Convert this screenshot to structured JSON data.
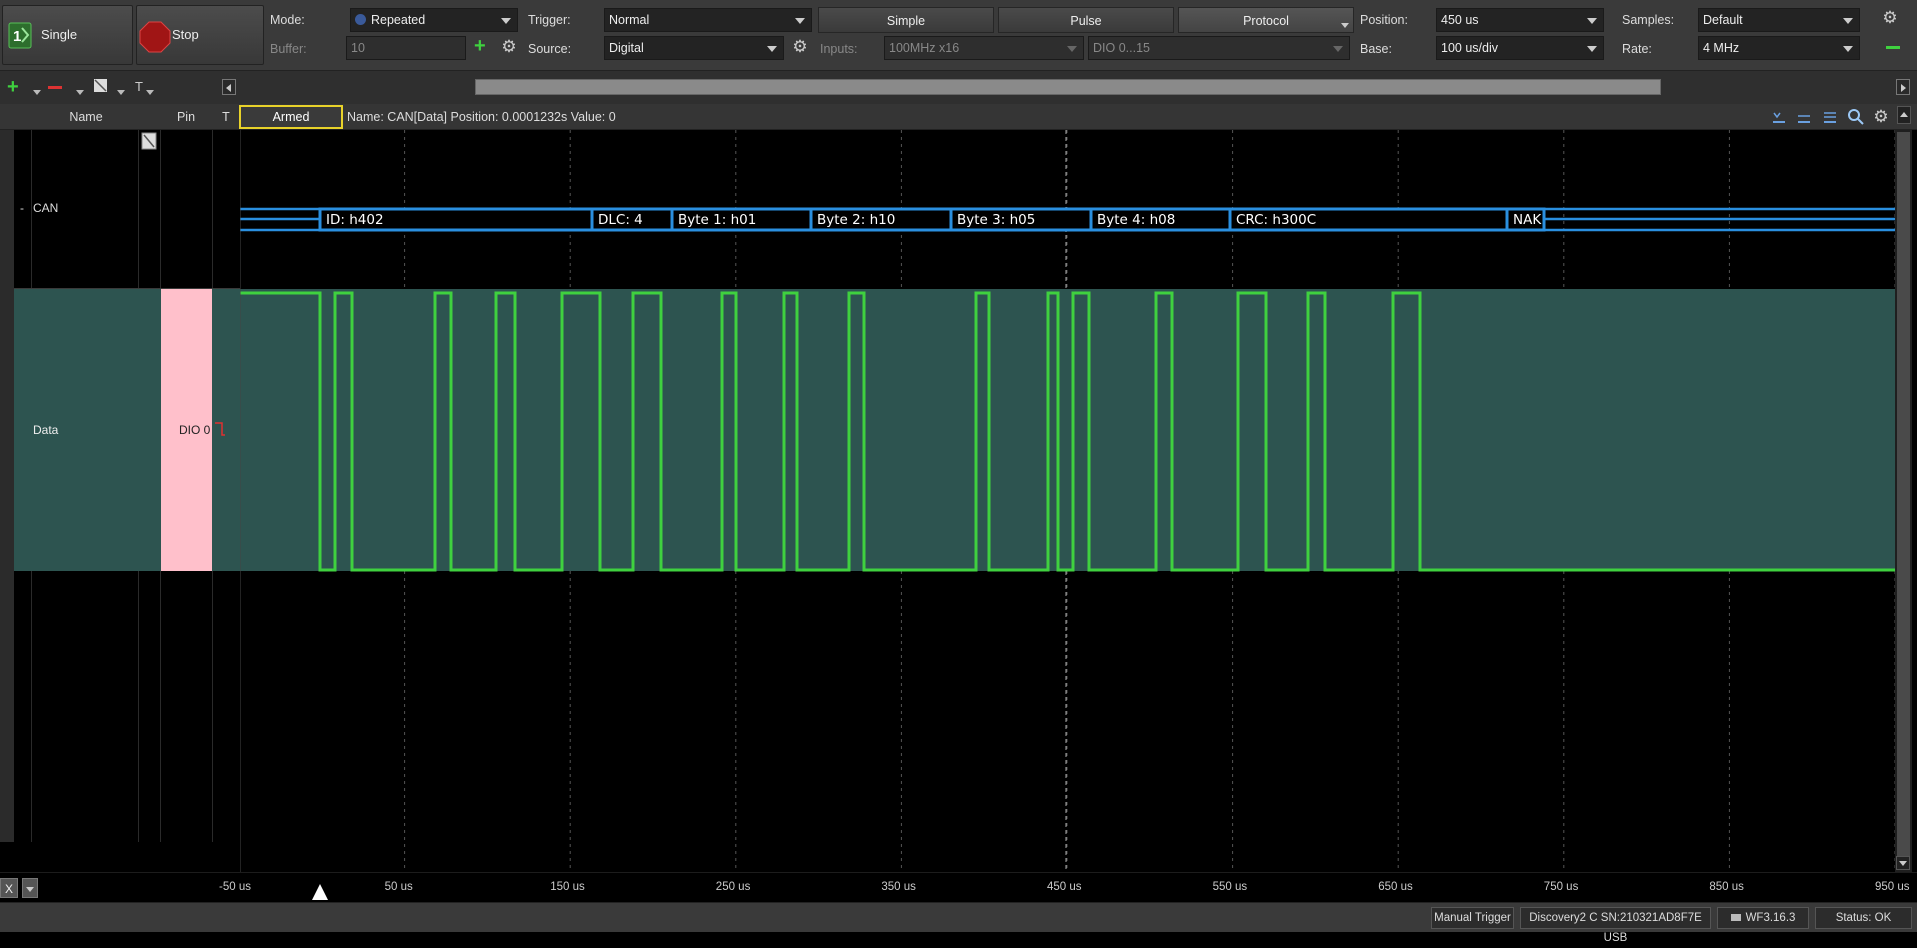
{
  "toolbar": {
    "single_label": "Single",
    "stop_label": "Stop",
    "mode_label": "Mode:",
    "mode_value": "Repeated",
    "buffer_label": "Buffer:",
    "buffer_value": "10",
    "trigger_label": "Trigger:",
    "trigger_value": "Normal",
    "source_label": "Source:",
    "source_value": "Digital",
    "inputs_label": "Inputs:",
    "inputs_value": "100MHz x16",
    "dio_range_value": "DIO 0...15",
    "tabs": [
      "Simple",
      "Pulse",
      "Protocol"
    ],
    "position_label": "Position:",
    "position_value": "450 us",
    "base_label": "Base:",
    "base_value": "100 us/div",
    "samples_label": "Samples:",
    "samples_value": "Default",
    "rate_label": "Rate:",
    "rate_value": "4 MHz"
  },
  "header": {
    "name_col": "Name",
    "pin_col": "Pin",
    "t_col": "T",
    "armed": "Armed",
    "info": "Name: CAN[Data]  Position: 0.0001232s  Value: 0"
  },
  "channels": {
    "can": {
      "toggle": "-",
      "name": "CAN"
    },
    "data": {
      "name": "Data",
      "pin": "DIO  0"
    }
  },
  "decode": [
    {
      "label": "ID: h402"
    },
    {
      "label": "DLC: 4"
    },
    {
      "label": "Byte 1: h01"
    },
    {
      "label": "Byte 2: h10"
    },
    {
      "label": "Byte 3: h05"
    },
    {
      "label": "Byte 4: h08"
    },
    {
      "label": "CRC: h300C"
    },
    {
      "label": "NAK"
    }
  ],
  "axis": {
    "ticks": [
      "-50 us",
      "50 us",
      "150 us",
      "250 us",
      "350 us",
      "450 us",
      "550 us",
      "650 us",
      "750 us",
      "850 us",
      "950 us"
    ]
  },
  "colors": {
    "signal": "#3fd13f",
    "bus": "#2a8fdf",
    "data_bg": "#2d5450",
    "pin_bg": "#ffc0cb"
  },
  "status": {
    "x_label": "X",
    "manual_trigger": "Manual Trigger",
    "device": "Discovery2 C SN:210321AD8F7E USB",
    "version": "WF3.16.3",
    "status": "Status: OK"
  }
}
